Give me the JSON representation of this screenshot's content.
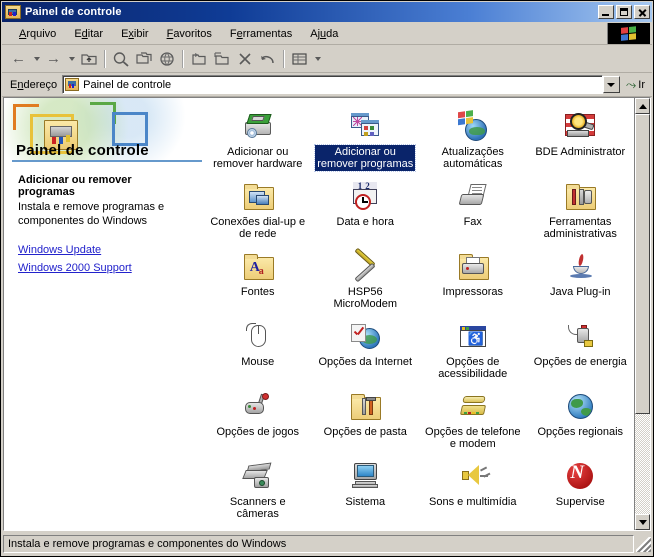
{
  "window": {
    "title": "Painel de controle",
    "icon": "control-panel-folder-icon",
    "buttons": {
      "minimize": "_",
      "maximize": "□",
      "close": "✕"
    }
  },
  "menubar": {
    "items": [
      {
        "label": "Arquivo",
        "accel": "A"
      },
      {
        "label": "Editar",
        "accel": "d"
      },
      {
        "label": "Exibir",
        "accel": "x"
      },
      {
        "label": "Favoritos",
        "accel": "F"
      },
      {
        "label": "Ferramentas",
        "accel": "e"
      },
      {
        "label": "Ajuda",
        "accel": "u"
      }
    ]
  },
  "toolbar": {
    "buttons": [
      {
        "name": "back",
        "label": "Voltar",
        "icon": "left-arrow-icon",
        "has_dropdown": true
      },
      {
        "name": "forward",
        "label": "Avançar",
        "icon": "right-arrow-icon",
        "has_dropdown": true
      },
      {
        "name": "up",
        "label": "Acima",
        "icon": "up-folder-icon",
        "has_dropdown": false
      },
      {
        "name": "search",
        "label": "Pesquisar",
        "icon": "search-icon",
        "has_dropdown": false
      },
      {
        "name": "folders",
        "label": "Pastas",
        "icon": "folders-icon",
        "has_dropdown": false
      },
      {
        "name": "history",
        "label": "Histórico",
        "icon": "history-globe-icon",
        "has_dropdown": false
      },
      {
        "name": "move-to",
        "label": "Mover para",
        "icon": "move-to-folder-icon",
        "has_dropdown": false
      },
      {
        "name": "copy-to",
        "label": "Copiar para",
        "icon": "copy-to-folder-icon",
        "has_dropdown": false
      },
      {
        "name": "delete",
        "label": "Excluir",
        "icon": "delete-x-icon",
        "has_dropdown": false
      },
      {
        "name": "undo",
        "label": "Desfazer",
        "icon": "undo-arrow-icon",
        "has_dropdown": false
      },
      {
        "name": "views",
        "label": "Modos de exibição",
        "icon": "views-icon",
        "has_dropdown": true
      }
    ]
  },
  "address": {
    "label": "Endereço",
    "value": "Painel de controle",
    "icon": "control-panel-folder-icon",
    "go_label": "Ir",
    "go_icon": "go-arrow-icon"
  },
  "left_pane": {
    "banner_title": "Painel de controle",
    "selected_title": "Adicionar ou remover programas",
    "selected_description": "Instala e remove programas e componentes do Windows",
    "links": [
      {
        "label": "Windows Update"
      },
      {
        "label": "Windows 2000 Support"
      }
    ]
  },
  "icons": [
    {
      "label": "Adicionar ou remover hardware",
      "icon": "add-remove-hardware-icon",
      "selected": false
    },
    {
      "label": "Adicionar ou remover programas",
      "icon": "add-remove-programs-icon",
      "selected": true
    },
    {
      "label": "Atualizações automáticas",
      "icon": "automatic-updates-icon",
      "selected": false
    },
    {
      "label": "BDE Administrator",
      "icon": "bde-administrator-icon",
      "selected": false
    },
    {
      "label": "Conexões dial-up e de rede",
      "icon": "network-dialup-connections-icon",
      "selected": false
    },
    {
      "label": "Data e hora",
      "icon": "date-time-icon",
      "selected": false
    },
    {
      "label": "Fax",
      "icon": "fax-icon",
      "selected": false
    },
    {
      "label": "Ferramentas administrativas",
      "icon": "administrative-tools-icon",
      "selected": false
    },
    {
      "label": "Fontes",
      "icon": "fonts-icon",
      "selected": false
    },
    {
      "label": "HSP56 MicroModem",
      "icon": "hsp56-micromodem-icon",
      "selected": false
    },
    {
      "label": "Impressoras",
      "icon": "printers-icon",
      "selected": false
    },
    {
      "label": "Java Plug-in",
      "icon": "java-plugin-icon",
      "selected": false
    },
    {
      "label": "Mouse",
      "icon": "mouse-icon",
      "selected": false
    },
    {
      "label": "Opções da Internet",
      "icon": "internet-options-icon",
      "selected": false
    },
    {
      "label": "Opções de acessibilidade",
      "icon": "accessibility-options-icon",
      "selected": false
    },
    {
      "label": "Opções de energia",
      "icon": "power-options-icon",
      "selected": false
    },
    {
      "label": "Opções de jogos",
      "icon": "gaming-options-icon",
      "selected": false
    },
    {
      "label": "Opções de pasta",
      "icon": "folder-options-icon",
      "selected": false
    },
    {
      "label": "Opções de telefone e modem",
      "icon": "phone-modem-options-icon",
      "selected": false
    },
    {
      "label": "Opções regionais",
      "icon": "regional-options-icon",
      "selected": false
    },
    {
      "label": "Scanners e câmeras",
      "icon": "scanners-cameras-icon",
      "selected": false
    },
    {
      "label": "Sistema",
      "icon": "system-icon",
      "selected": false
    },
    {
      "label": "Sons e multimídia",
      "icon": "sounds-multimedia-icon",
      "selected": false
    },
    {
      "label": "Supervise",
      "icon": "supervise-icon",
      "selected": false
    }
  ],
  "scrollbar": {
    "up_icon": "scroll-up-arrow-icon",
    "down_icon": "scroll-down-arrow-icon",
    "thumb_fraction": 0.75
  },
  "statusbar": {
    "text": "Instala e remove programas e componentes do Windows"
  },
  "colors": {
    "title_start": "#0a246a",
    "title_end": "#a6c8f0",
    "selection": "#0a246a",
    "link": "#2222cc",
    "face": "#d4d0c8",
    "banner_rule": "#6699cc"
  }
}
